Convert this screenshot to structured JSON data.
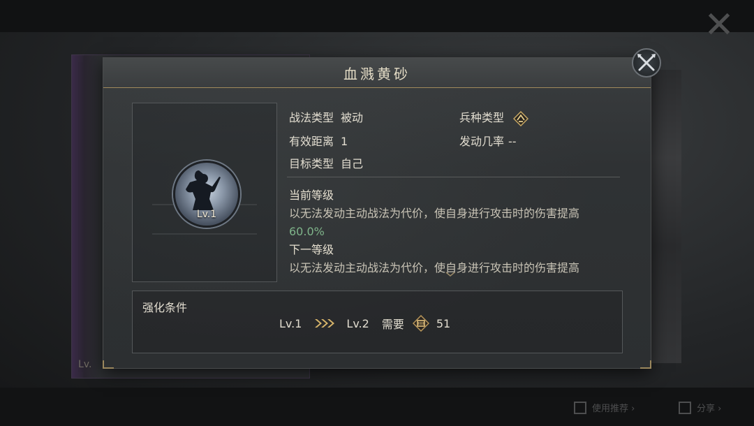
{
  "dialog": {
    "title": "血溅黄砂",
    "portrait_level": "Lv.1",
    "fields": {
      "tactic_type_label": "战法类型",
      "tactic_type_value": "被动",
      "troop_type_label": "兵种类型",
      "range_label": "有效距离",
      "range_value": "1",
      "trigger_rate_label": "发动几率",
      "trigger_rate_value": "--",
      "target_label": "目标类型",
      "target_value": "自己"
    },
    "current": {
      "heading": "当前等级",
      "text": "以无法发动主动战法为代价，使自身进行攻击时的伤害提高",
      "value": "60.0%"
    },
    "next": {
      "heading": "下一等级",
      "text": "以无法发动主动战法为代价，使自身进行攻击时的伤害提高"
    },
    "upgrade": {
      "title": "强化条件",
      "from_level": "Lv.1",
      "to_level": "Lv.2",
      "need_label": "需要",
      "cost": "51"
    }
  },
  "background": {
    "bottom_left_tag": "Lv.",
    "bottom_buttons": [
      "使用推荐 ›",
      "分享 ›"
    ]
  },
  "colors": {
    "accent_gold": "#a08a5c",
    "highlight_green": "#7fb48a"
  },
  "icons": [
    "close-icon",
    "troop-type-icon",
    "triple-chevron-icon",
    "token-icon",
    "scroll-down-icon"
  ]
}
